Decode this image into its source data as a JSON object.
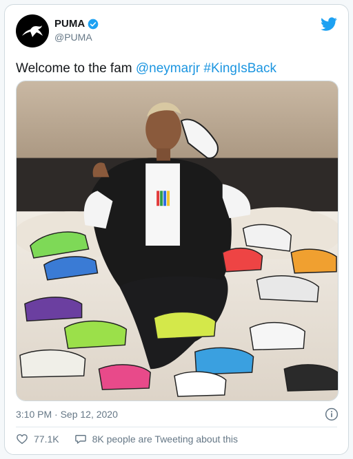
{
  "tweet": {
    "author": {
      "display_name": "PUMA",
      "handle": "@PUMA",
      "verified_icon": "verified-badge-icon",
      "avatar_icon": "puma-logo-icon"
    },
    "brand_icon": "twitter-bird-icon",
    "text_prefix": "Welcome to the fam ",
    "mention": "@neymarjr",
    "hashtag": "#KingIsBack",
    "timestamp": "3:10 PM · Sep 12, 2020",
    "likes": "77.1K",
    "conversation_label": "8K people are Tweeting about this",
    "colors": {
      "link": "#1b95e0",
      "twitter_blue": "#1da1f2",
      "muted": "#657786"
    }
  }
}
